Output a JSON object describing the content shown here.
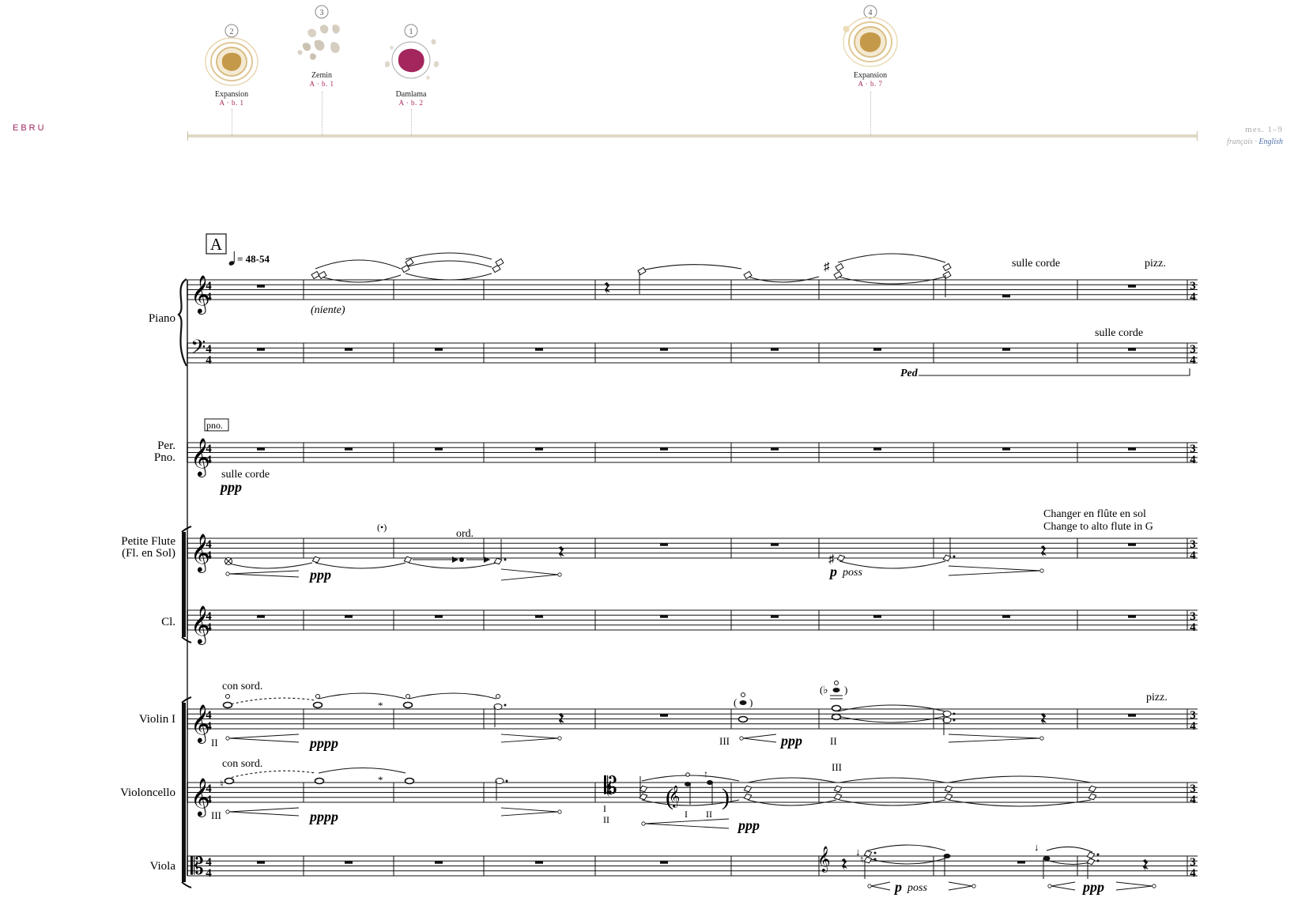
{
  "app": {
    "title": "EBRU"
  },
  "timeline": {
    "markers": [
      {
        "number": "2",
        "name": "Expansion",
        "ref": "A · b. 1",
        "color": "#c49a4a"
      },
      {
        "number": "3",
        "name": "Zemin",
        "ref": "A · b. 1",
        "color": "#d5cdbf"
      },
      {
        "number": "1",
        "name": "Damlama",
        "ref": "A · b. 2",
        "color": "#a3265d"
      },
      {
        "number": "4",
        "name": "Expansion",
        "ref": "A · b. 7",
        "color": "#c49a4a"
      }
    ],
    "range": "mes. 1–9",
    "languages": {
      "fr": "français",
      "sep": " · ",
      "en": "English"
    }
  },
  "score": {
    "rehearsal": "A",
    "tempo": "= 48-54",
    "time_signature": "4/4",
    "next_time_signature": "3/4",
    "instruments": {
      "piano": "Piano",
      "per_pno_1": "Per.",
      "per_pno_2": "Pno.",
      "piccolo_1": "Petite Flute",
      "piccolo_2": "(Fl. en Sol)",
      "clarinet": "Cl.",
      "violin": "Violin I",
      "cello": "Violoncello",
      "viola": "Viola"
    },
    "texts": {
      "niente": "(niente)",
      "sulle_corde_1": "sulle corde",
      "pizz_1": "pizz.",
      "sulle_corde_2": "sulle corde",
      "ped": "Ped",
      "pno_box": "pno.",
      "sulle_corde_3": "sulle corde",
      "ppp_1": "ppp",
      "paren_dot": "(•)",
      "ord": "ord.",
      "change_fr": "Changer en flûte en sol",
      "change_en": "Change to alto flute in G",
      "ppp_fl": "ppp",
      "p_fl": "p",
      "poss_fl": "poss",
      "con_sord_1": "con sord.",
      "con_sord_2": "con sord.",
      "pizz_2": "pizz.",
      "pppp_vn": "pppp",
      "pppp_vc": "pppp",
      "ppp_vn": "ppp",
      "ppp_vc": "ppp",
      "roman_II_vn": "II",
      "roman_III_vn": "III",
      "roman_II_vn2": "II",
      "roman_III_vc": "III",
      "roman_III_vc2": "III",
      "roman_I_vc": "I",
      "roman_II_vc": "II",
      "roman_I_vc2": "I",
      "roman_II_vc2": "II",
      "p_va": "p",
      "poss_va": "poss",
      "ppp_va": "ppp"
    }
  }
}
